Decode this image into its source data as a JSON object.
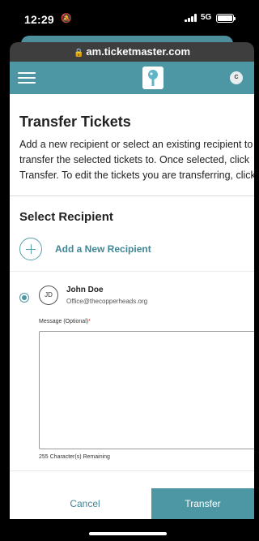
{
  "status_bar": {
    "time": "12:29",
    "network": "5G"
  },
  "browser": {
    "url": "am.ticketmaster.com"
  },
  "header": {
    "avatar_initial": "C"
  },
  "page": {
    "title": "Transfer Tickets",
    "description_lines": [
      "Add a new recipient or select an existing recipient to",
      "transfer the selected tickets to. Once selected, click",
      "Transfer. To edit the tickets you are transferring, click"
    ],
    "section_title": "Select Recipient",
    "add_recipient_label": "Add a New Recipient",
    "recipient": {
      "initials": "JD",
      "name": "John Doe",
      "email": "Office@thecopperheads.org",
      "selected": true
    },
    "message_label": "Message (Optional)",
    "message_required_mark": "*",
    "message_value": "",
    "chars_remaining": "255 Character(s) Remaining"
  },
  "footer": {
    "cancel_label": "Cancel",
    "transfer_label": "Transfer"
  },
  "colors": {
    "accent": "#4d96a4",
    "link": "#3f8796"
  }
}
